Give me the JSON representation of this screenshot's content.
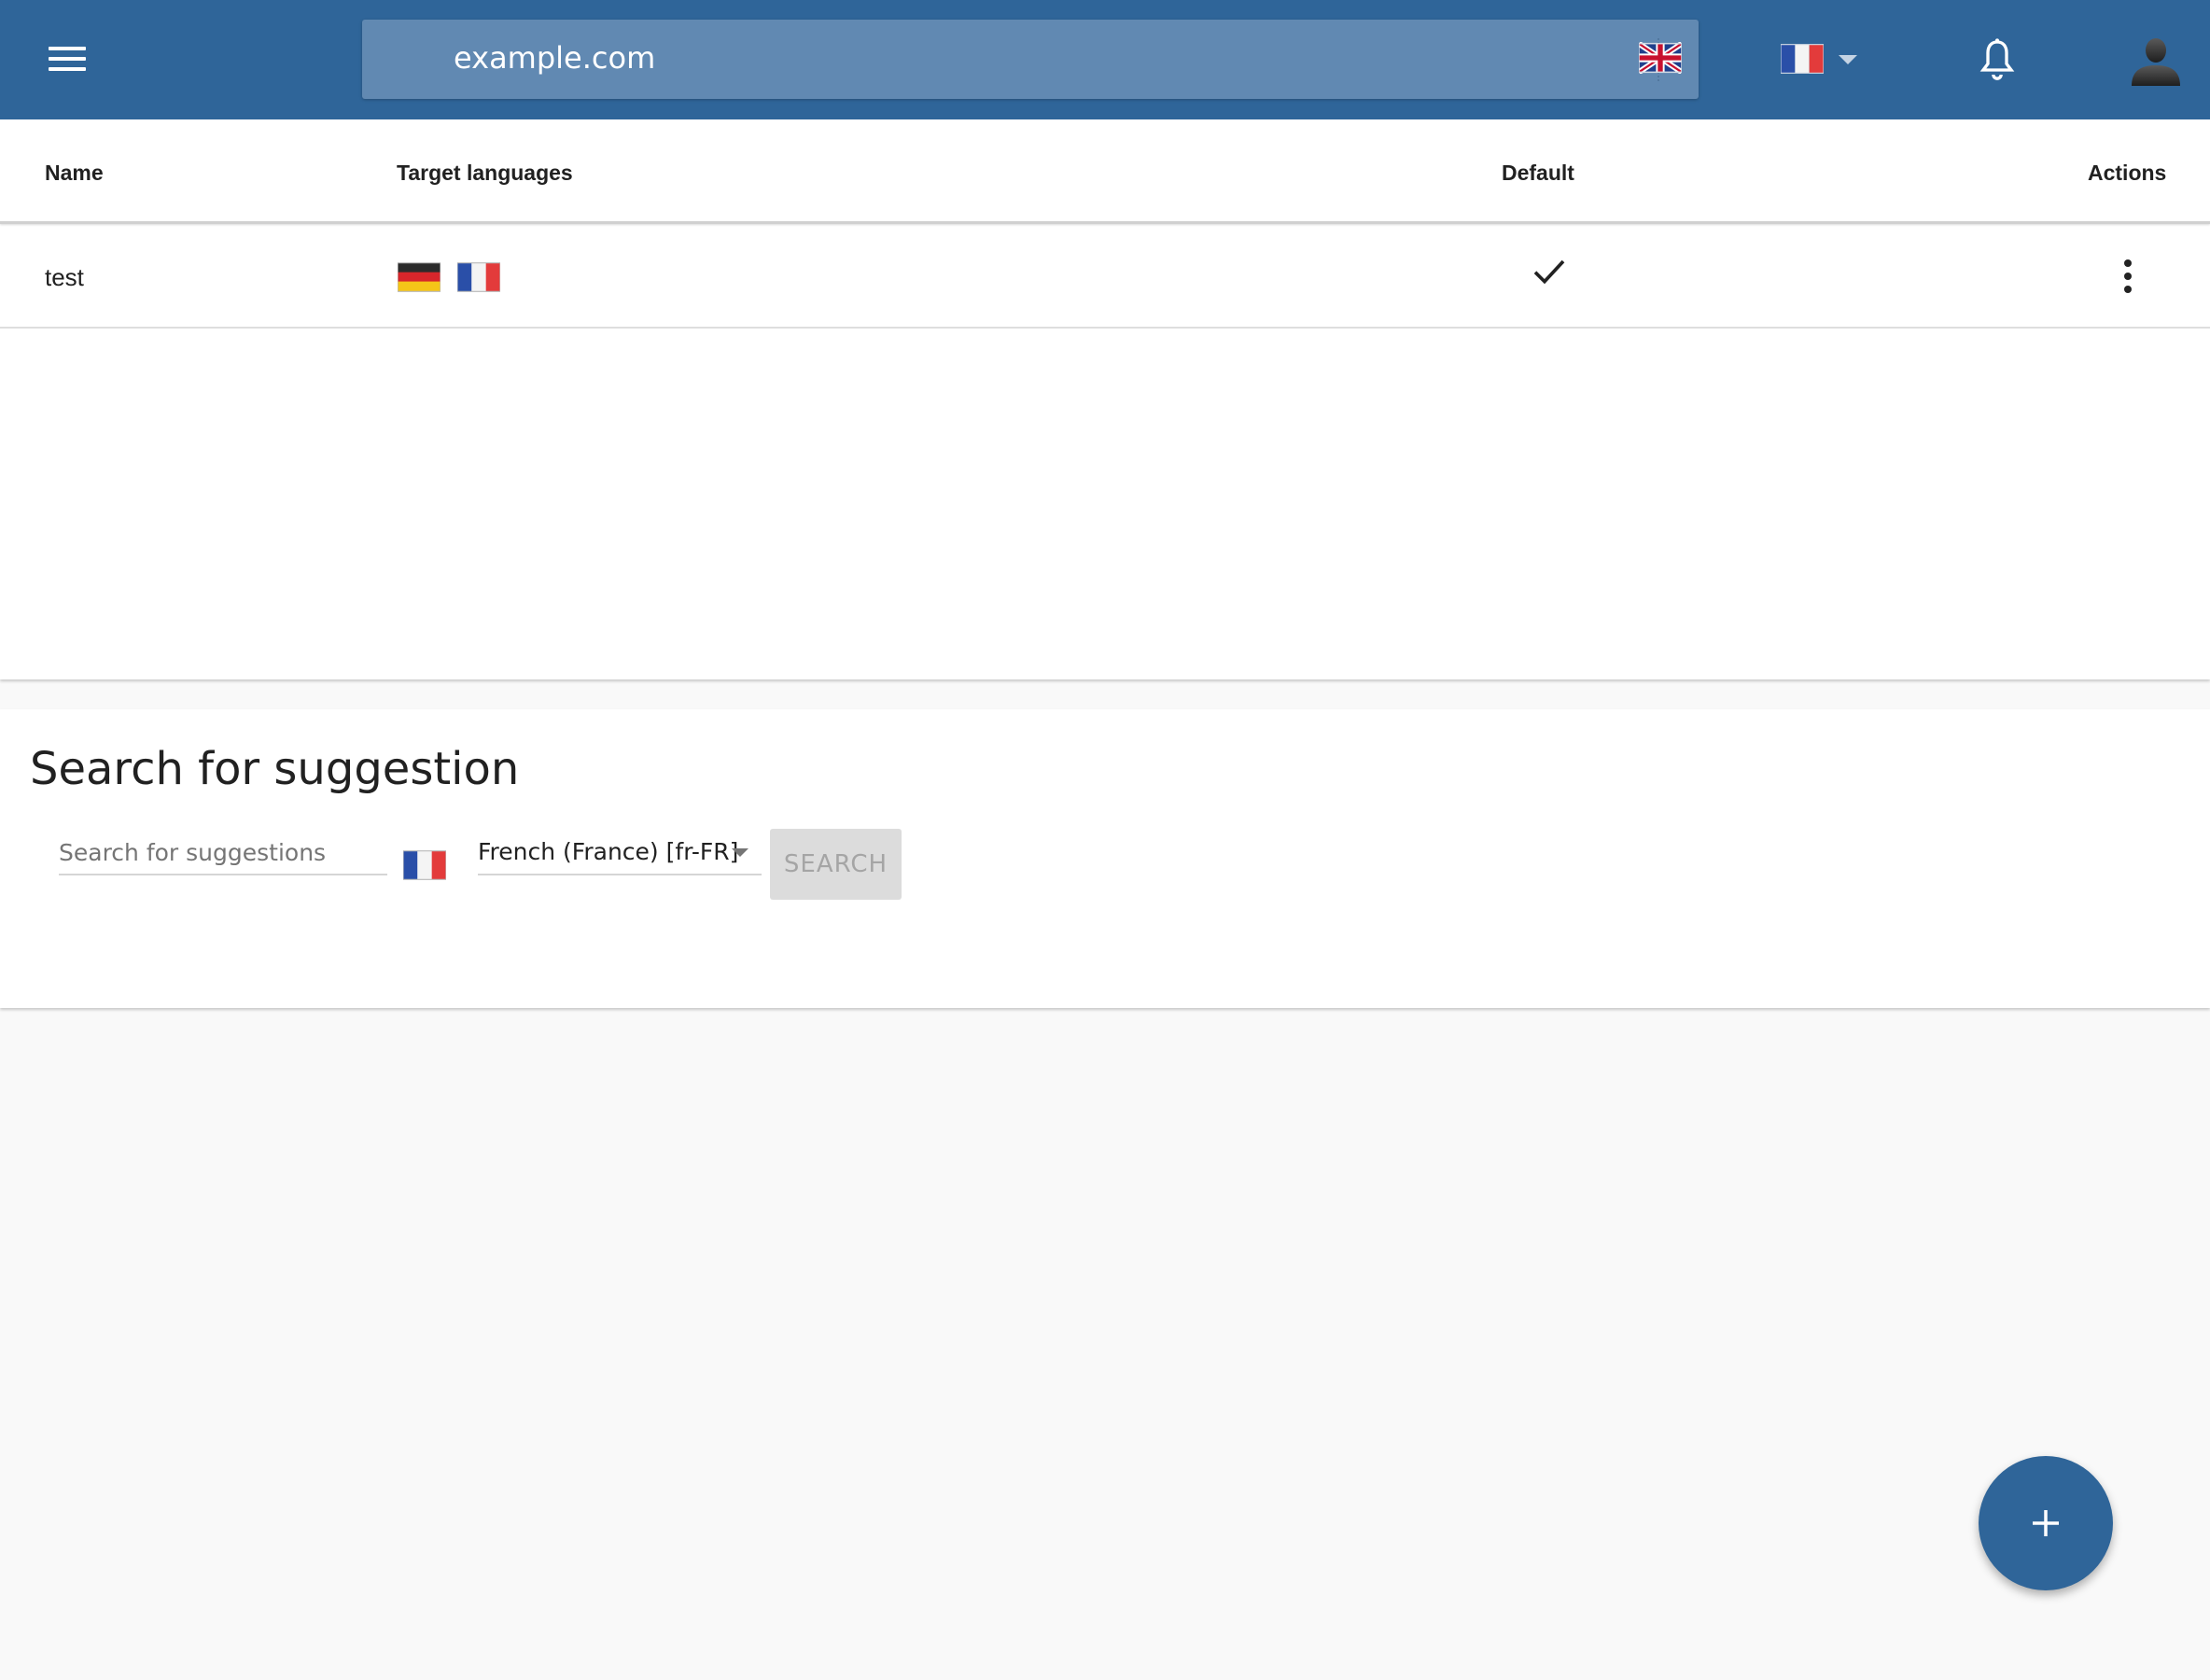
{
  "header": {
    "url": "example.com",
    "url_flag": "flag-uk-icon",
    "language_flag": "flag-fr-icon",
    "menu_icon": "hamburger-menu-icon",
    "notification_icon": "bell-icon",
    "user_icon": "user-avatar-icon",
    "brand_color": "#2f6599"
  },
  "table": {
    "columns": [
      "Name",
      "Target languages",
      "Default",
      "Actions"
    ],
    "rows": [
      {
        "name": "test",
        "target_languages": [
          "flag-de-icon",
          "flag-fr-icon"
        ],
        "default": true,
        "actions_icon": "more-vert-icon"
      }
    ]
  },
  "search": {
    "title": "Search for suggestion",
    "input_placeholder": "Search for suggestions",
    "input_value": "",
    "language_flag": "flag-fr-icon",
    "language_selected": "French (France) [fr-FR]",
    "button_label": "SEARCH"
  },
  "fab": {
    "icon": "plus-icon",
    "color": "#2f6599"
  }
}
